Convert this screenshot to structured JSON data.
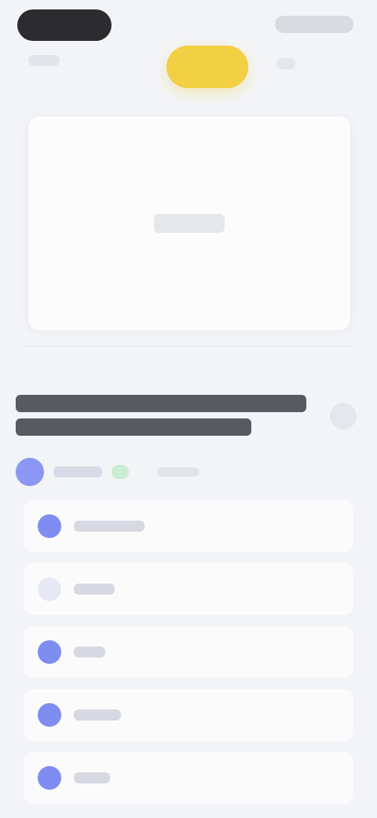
{
  "header": {
    "left_pill_label": "",
    "right_label": "",
    "center_button_label": "",
    "accent_color": "#f2cf43"
  },
  "preview": {
    "label": ""
  },
  "article": {
    "title": "",
    "author": "",
    "time": ""
  },
  "steps": [
    {
      "label": "",
      "active": true
    },
    {
      "label": "",
      "active": false
    },
    {
      "label": "",
      "active": true
    },
    {
      "label": "",
      "active": true
    },
    {
      "label": "",
      "active": true
    }
  ]
}
